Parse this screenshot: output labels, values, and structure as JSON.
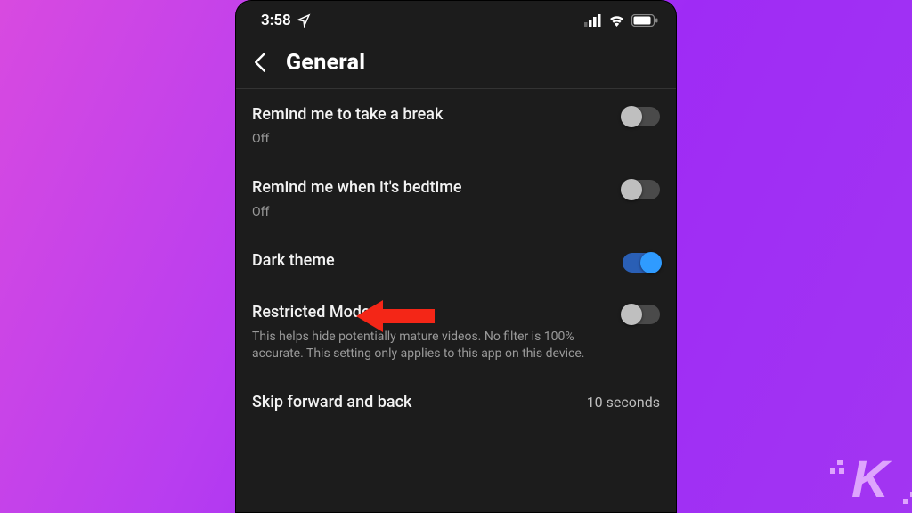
{
  "statusbar": {
    "time": "3:58",
    "location_icon": "location-arrow",
    "cell_icon": "cell-signal",
    "wifi_icon": "wifi",
    "battery_icon": "battery"
  },
  "header": {
    "back_icon": "chevron-left",
    "title": "General"
  },
  "rows": {
    "break": {
      "label": "Remind me to take a break",
      "sub": "Off",
      "on": false
    },
    "bedtime": {
      "label": "Remind me when it's bedtime",
      "sub": "Off",
      "on": false
    },
    "dark": {
      "label": "Dark theme",
      "on": true
    },
    "restricted": {
      "label": "Restricted Mode",
      "sub": "This helps hide potentially mature videos. No filter is 100% accurate. This setting only applies to this app on this device.",
      "on": false
    },
    "skip": {
      "label": "Skip forward and back",
      "value": "10 seconds"
    }
  },
  "annotation": {
    "arrow": "red-arrow-left"
  },
  "watermark": {
    "letter": "K"
  },
  "colors": {
    "accent": "#2f9bff",
    "track_on": "#2a5fb5",
    "arrow": "#f42617"
  }
}
